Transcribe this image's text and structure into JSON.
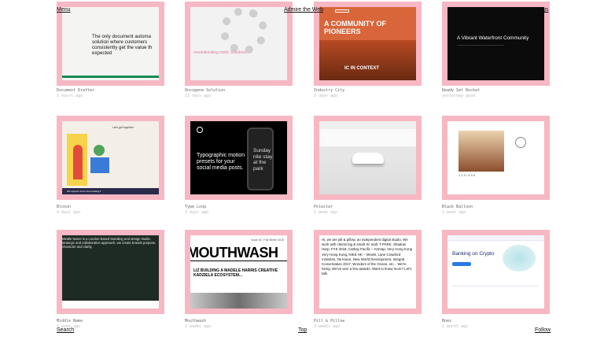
{
  "nav": {
    "menu": "Menu",
    "center": "Admire the Web",
    "right_partial": "gs",
    "search": "Search",
    "top": "Top",
    "follow": "Follow"
  },
  "cards": [
    {
      "title": "Document Drafter",
      "meta": "3 hours ago",
      "preview_text": "The only document automa solution where customers consistently get the value th expected"
    },
    {
      "title": "Oncogene Solution",
      "meta": "13 days ago",
      "preview_text": "revolutionising metic Solutions"
    },
    {
      "title": "Industry City",
      "meta": "3 days ago",
      "preview_text": "A COMMUNITY OF PIONEERS",
      "preview_label": "IC IN CONTEXT"
    },
    {
      "title": "Ready Set Rocket",
      "meta": "yesterday good",
      "preview_text": "A Vibrant Waterfront Community"
    },
    {
      "title": "Bloxon",
      "meta": "4 days ago",
      "preview_text": "Let's get together",
      "preview_footer": "We support art for love funding it"
    },
    {
      "title": "Type Loop",
      "meta": "3 days ago",
      "preview_text": "Typographic motion presets for your social media posts.",
      "preview_phone": "Sunday nite stay at the park"
    },
    {
      "title": "Polestar",
      "meta": "1 week ago"
    },
    {
      "title": "Black Balloon",
      "meta": "1 week ago",
      "preview_text": "1 2 3 / 4 5 6"
    },
    {
      "title": "Middle Name",
      "meta": "1 week ago",
      "preview_text": "Middle Name is a London-based branding and design studio. strategic and collaborative approach, we create brands purpose, character and clarity."
    },
    {
      "title": "Mouthwash",
      "meta": "2 weeks ago",
      "preview_header": "Issue 02 / Fall Winter 2019",
      "preview_big": "MOUTHWASH",
      "preview_row": "LIZ BUILDING A MADELE HARRIS CREATIVE KADZIELA ECOSYSTEM..."
    },
    {
      "title": "Pill & Pillow",
      "meta": "3 weeks ago",
      "preview_text": "Hi, we are pill & pillow, an independent digital studio. We work with clients big & small: Ilc mall, T-PARK, Shadow Harp, FYE 2018, Cathay Pacific – Artmap, Very Hong Kong Very Hong Kong, NIKE HK – MsoW, Lane Crawford minisites, Tai Kwun, New World Development, Integral Conversation 2017, Wonders of the Ocean, etc... We're hiring. We've won a few awards. Want to know more? Let's talk."
    },
    {
      "title": "Bnex",
      "meta": "1 month ago",
      "preview_text": "Banking on Crypto"
    }
  ]
}
